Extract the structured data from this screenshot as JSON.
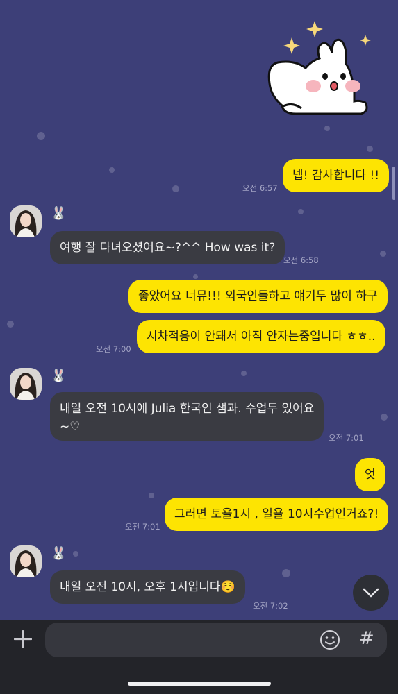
{
  "messages": [
    {
      "from": "me",
      "text": "넵! 감사합니다 !!",
      "time": "오전 6:57"
    },
    {
      "from": "them",
      "text": "여행 잘 다녀오셨어요~?^^ How was it?",
      "time": "오전 6:58"
    },
    {
      "from": "me",
      "text": "좋았어요 너뮤!!! 외국인들하고 얘기두 많이 하구"
    },
    {
      "from": "me",
      "text": "시차적응이 안돼서 아직 안자는중입니다 ㅎㅎ..",
      "time": "오전 7:00"
    },
    {
      "from": "them",
      "text": "내일 오전 10시에 Julia 한국인 샘과. 수업두 있어요",
      "text2": "~♡",
      "time": "오전 7:01"
    },
    {
      "from": "me",
      "text": "엇"
    },
    {
      "from": "me",
      "text": "그러면 토욜1시 , 일욜 10시수업인거죠?!",
      "time": "오전 7:01"
    },
    {
      "from": "them",
      "text": "내일 오전 10시, 오후 1시입니다☺️",
      "time": "오전 7:02"
    }
  ],
  "colors": {
    "background": "#3d3f78",
    "my_bubble": "#fde402",
    "their_bubble": "#3a3b42"
  }
}
